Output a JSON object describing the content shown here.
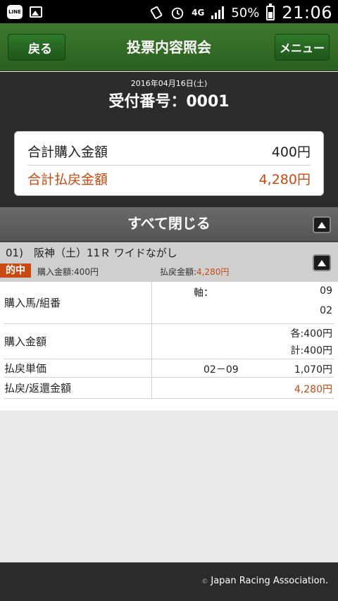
{
  "status_bar": {
    "left_icons": [
      "line-app-icon",
      "image-icon"
    ],
    "line_label": "LINE",
    "right_icons": [
      "vibrate-icon",
      "alarm-icon",
      "4g-icon",
      "signal-icon",
      "battery-icon"
    ],
    "network": "4G",
    "battery": "50%",
    "time": "21:06"
  },
  "header": {
    "back_label": "戻る",
    "title": "投票内容照会",
    "menu_label": "メニュー"
  },
  "receipt": {
    "date": "2016年04月16日(土)",
    "number": "受付番号：0001"
  },
  "totals": {
    "purchase_label": "合計購入金額",
    "purchase_value": "400円",
    "payout_label": "合計払戻金額",
    "payout_value": "4,280円"
  },
  "close_all_label": "すべて閉じる",
  "race": {
    "title": "01)　阪神（土）11Ｒ ワイドながし",
    "hit_label": "的中",
    "buy_text": "購入金額:400円",
    "pay_label": "払戻金額:",
    "pay_value": "4,280円"
  },
  "details": {
    "horses_label": "購入馬/組番",
    "axis_label": "軸：",
    "axis_value": "09",
    "pair_value": "02",
    "amount_label": "購入金額",
    "each_value": "各:400円",
    "total_value": "計:400円",
    "unit_label": "払戻単価",
    "combo": "02－09",
    "unit_value": "1,070円",
    "refund_label": "払戻/返還金額",
    "refund_value": "4,280円"
  },
  "footer": {
    "copyright_symbol": "©",
    "text": "Japan Racing Association."
  },
  "colors": {
    "header_green": "#2b5f1f",
    "accent_orange": "#c84a12",
    "dark_band": "#2b2b2b"
  }
}
